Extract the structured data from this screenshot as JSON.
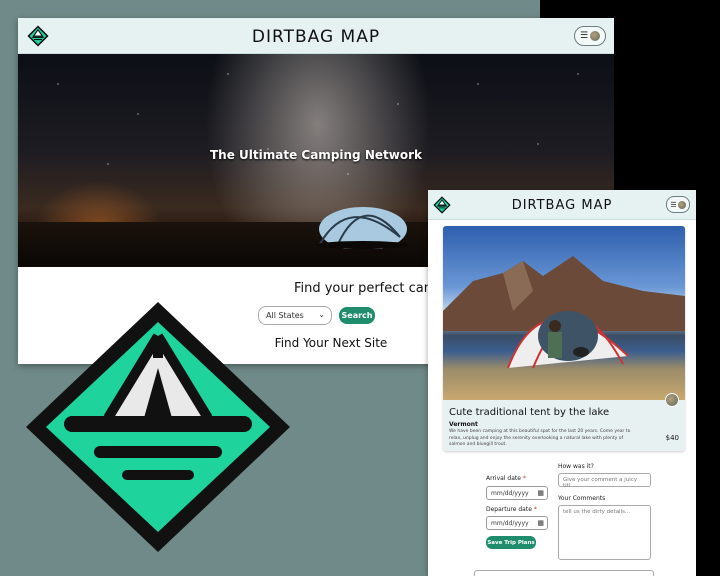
{
  "colors": {
    "accent": "#1f8d6c",
    "logo_green": "#1fd49c",
    "nav_bg": "#e6f1f2",
    "background": "#6f8a88"
  },
  "desktop": {
    "title": "DIRTBAG MAP",
    "tagline": "The Ultimate Camping Network",
    "find_prompt": "Find your perfect camping getaway...",
    "state_select": {
      "value": "All States"
    },
    "search_label": "Search",
    "next_site": "Find Your Next Site",
    "menu_icon": "hamburger-icon"
  },
  "mobile": {
    "title": "DIRTBAG MAP",
    "card": {
      "title": "Cute traditional tent by the lake",
      "state": "Vermont",
      "description": "We have been camping at this beautiful spot for the last 20 years. Come year to relax, unplug and enjoy the serenity overlooking a natural lake with plenty of salmon and bluegill trout.",
      "price": "$40"
    },
    "form": {
      "arrival_label": "Arrival date",
      "departure_label": "Departure date",
      "required_mark": "*",
      "date_placeholder": "mm/dd/yyyy",
      "save_label": "Save Trip Plans",
      "how_label": "How was it?",
      "comment_placeholder": "Give your comment a juicy titl",
      "comments_label": "Your Comments",
      "comments_placeholder": "tell us the dirty details..."
    }
  }
}
